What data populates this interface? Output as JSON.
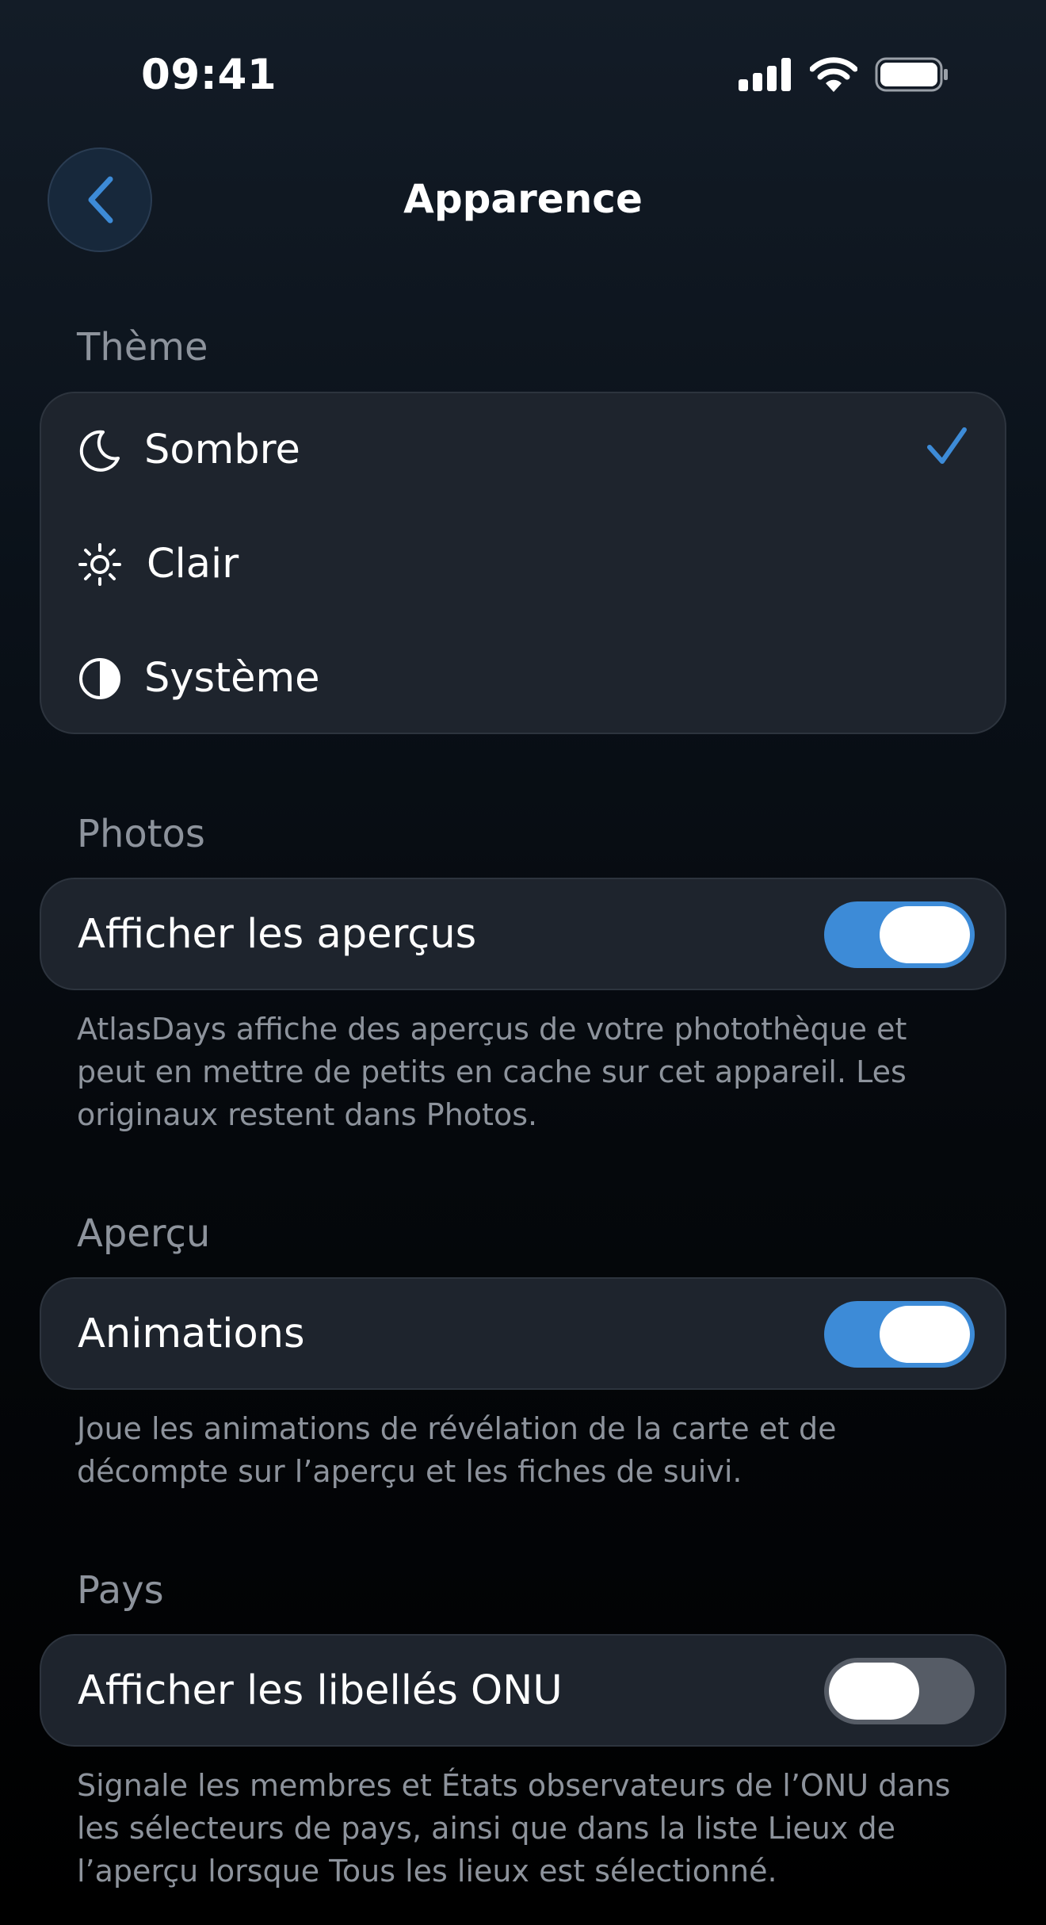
{
  "status_bar": {
    "time": "09:41"
  },
  "nav": {
    "title": "Apparence",
    "back_icon": "chevron-left-icon"
  },
  "theme": {
    "header": "Thème",
    "options": [
      {
        "label": "Sombre",
        "icon": "moon-icon",
        "selected": true
      },
      {
        "label": "Clair",
        "icon": "sun-icon",
        "selected": false
      },
      {
        "label": "Système",
        "icon": "contrast-icon",
        "selected": false
      }
    ]
  },
  "photos": {
    "header": "Photos",
    "row_label": "Afficher les aperçus",
    "toggle_on": true,
    "footnote": "AtlasDays affiche des aperçus de votre photothèque et peut en mettre de petits en cache sur cet appareil. Les originaux restent dans Photos."
  },
  "apercu": {
    "header": "Aperçu",
    "row_label": "Animations",
    "toggle_on": true,
    "footnote": "Joue les animations de révélation de la carte et de décompte sur l’aperçu et les fiches de suivi."
  },
  "pays": {
    "header": "Pays",
    "row_label": "Afficher les libellés ONU",
    "toggle_on": false,
    "footnote": "Signale les membres et États observateurs de l’ONU dans les sélecteurs de pays, ainsi que dans la liste Lieux de l’aperçu lorsque Tous les lieux est sélectionné."
  },
  "colors": {
    "accent": "#3d8bd7",
    "background": "#0a1119",
    "card": "#1e242d",
    "secondary_text": "#8d939c",
    "toggle_off": "#565c66"
  }
}
